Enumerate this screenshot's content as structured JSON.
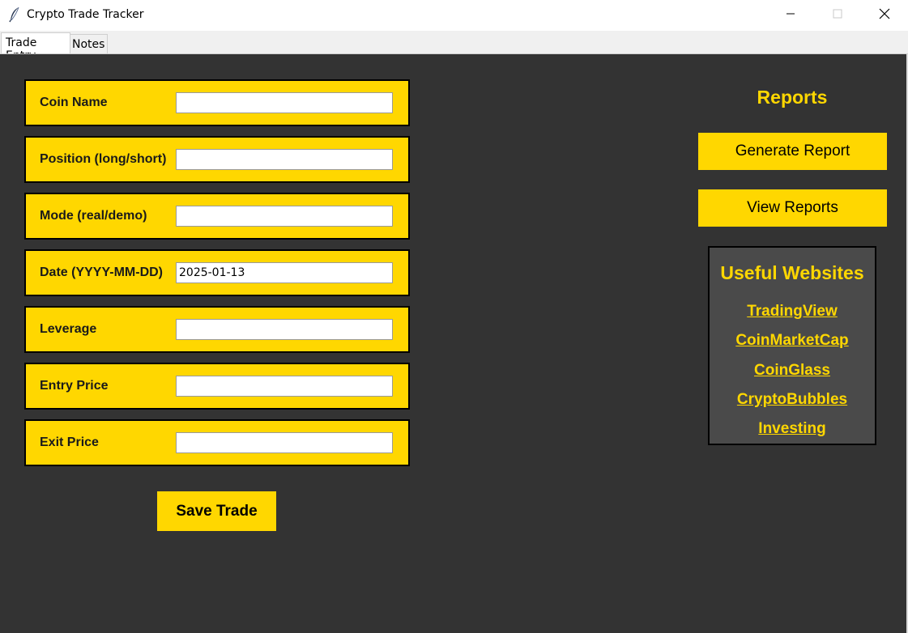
{
  "window": {
    "title": "Crypto Trade Tracker",
    "minimize_icon": "minimize-icon",
    "maximize_icon": "maximize-icon",
    "close_icon": "close-icon",
    "app_icon": "feather-icon"
  },
  "tabs": [
    {
      "label": "Trade Entry",
      "active": true
    },
    {
      "label": "Notes",
      "active": false
    }
  ],
  "form": {
    "fields": [
      {
        "label": "Coin Name",
        "value": ""
      },
      {
        "label": "Position (long/short)",
        "value": ""
      },
      {
        "label": "Mode (real/demo)",
        "value": ""
      },
      {
        "label": "Date (YYYY-MM-DD)",
        "value": "2025-01-13"
      },
      {
        "label": "Leverage",
        "value": ""
      },
      {
        "label": "Entry Price",
        "value": ""
      },
      {
        "label": "Exit Price",
        "value": ""
      }
    ],
    "save_label": "Save Trade"
  },
  "reports": {
    "title": "Reports",
    "generate_label": "Generate Report",
    "view_label": "View Reports"
  },
  "websites": {
    "title": "Useful Websites",
    "links": [
      "TradingView",
      "CoinMarketCap",
      "CoinGlass",
      "CryptoBubbles",
      "Investing"
    ]
  },
  "colors": {
    "background": "#333333",
    "accent": "#ffd700",
    "panel": "#4a4a4a"
  }
}
